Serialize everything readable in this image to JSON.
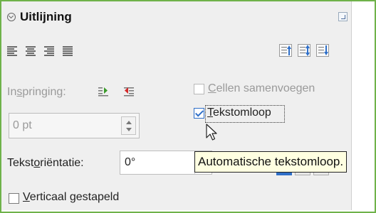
{
  "panel": {
    "title": "Uitlijning"
  },
  "indent": {
    "label_pre": "In",
    "label_mid": "s",
    "label_post": "pringing:",
    "spin_value": "0 pt"
  },
  "merge_cells": {
    "label_first": "C",
    "label_rest": "ellen samenvoegen",
    "checked": false,
    "enabled": false
  },
  "wrap_text": {
    "label_first": "T",
    "label_rest": "ekstomloop",
    "checked": true
  },
  "tooltip": {
    "text": "Automatische tekstomloop."
  },
  "orientation": {
    "label_pre": "Tekst",
    "label_mid": "o",
    "label_post": "riëntatie:",
    "value": "0°"
  },
  "vertical_stacked": {
    "label_first": "V",
    "label_rest": "erticaal gestapeld",
    "checked": false
  },
  "icons": {
    "collapse": "collapse-circle-icon",
    "more_options": "more-options-icon",
    "align_left": "align-left-icon",
    "align_center": "align-center-icon",
    "align_right": "align-right-icon",
    "align_justify": "align-justify-icon",
    "valign_top": "align-top-icon",
    "valign_center": "align-vertical-center-icon",
    "valign_bottom": "align-bottom-icon",
    "increase_indent": "increase-indent-icon",
    "decrease_indent": "decrease-indent-icon",
    "cursor": "mouse-pointer-icon"
  },
  "colors": {
    "accent_blue": "#2f6fc8",
    "frame_green": "#6fb24a",
    "tooltip_bg": "#ffffe1"
  }
}
